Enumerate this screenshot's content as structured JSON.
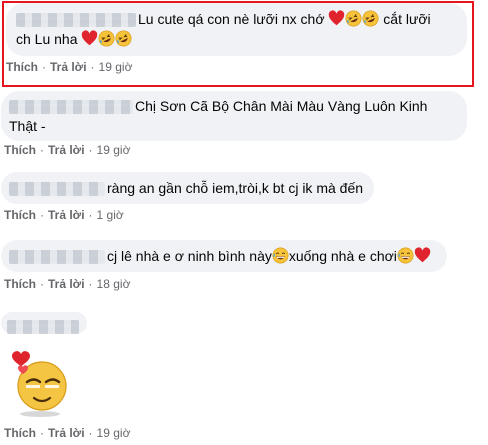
{
  "comments": [
    {
      "line1": "Lu cute qá con nè lưỡi nx chớ",
      "line1_tail": "cắt lưỡi",
      "line2": "ch Lu nha",
      "actions": {
        "like": "Thích",
        "reply": "Trả lời",
        "time": "19 giờ"
      }
    },
    {
      "line1": "Chị Sơn Cã Bộ Chân Mài Màu Vàng Luôn Kinh",
      "line2": "Thật -",
      "actions": {
        "like": "Thích",
        "reply": "Trả lời",
        "time": "19 giờ"
      }
    },
    {
      "line1": "ràng an gần chỗ iem,tròi,k bt cj ik mà đến",
      "actions": {
        "like": "Thích",
        "reply": "Trả lời",
        "time": "1 giờ"
      }
    },
    {
      "line1": "cj lê nhà e ơ ninh bình này",
      "line1_mid": "xuống nhà e chơi",
      "actions": {
        "like": "Thích",
        "reply": "Trả lời",
        "time": "18 giờ"
      }
    },
    {
      "sticker": "crying-love-emoji-sticker",
      "actions": {
        "like": "Thích",
        "reply": "Trả lời",
        "time": "19 giờ"
      }
    }
  ],
  "colors": {
    "highlight": "#e5161d",
    "bubble": "#f0f2f5",
    "meta": "#65676b"
  }
}
